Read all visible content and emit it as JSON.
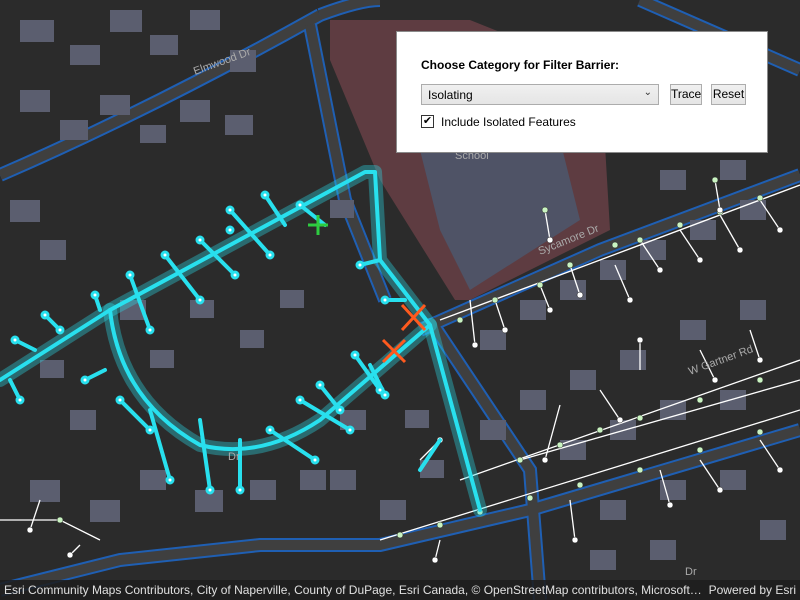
{
  "map": {
    "street_labels": [
      "Elmwood Dr",
      "Sycamore Dr",
      "W Gartner Rd",
      "School",
      "Dr",
      "Dr"
    ],
    "colors": {
      "background": "#2b2b2b",
      "road": "#3f3f3f",
      "road_casing": "#1f5fb3",
      "building": "#5b5e6f",
      "school_area": "#5e3c41",
      "trace_glow": "#28e0ee",
      "line_white": "#ffffff",
      "junction_fill": "#c9f3c1",
      "barrier": "#ff5a1e",
      "start_point": "#2ecc40"
    }
  },
  "panel": {
    "title": "Choose Category for Filter Barrier:",
    "category_selected": "Isolating",
    "trace_label": "Trace",
    "reset_label": "Reset",
    "include_isolated_checked": true,
    "include_isolated_label": "Include Isolated Features"
  },
  "attribution": {
    "text": "Esri Community Maps Contributors, City of Naperville, County of DuPage, Esri Canada, © OpenStreetMap contributors, Microsoft, E...",
    "powered_by": "Powered by Esri"
  }
}
